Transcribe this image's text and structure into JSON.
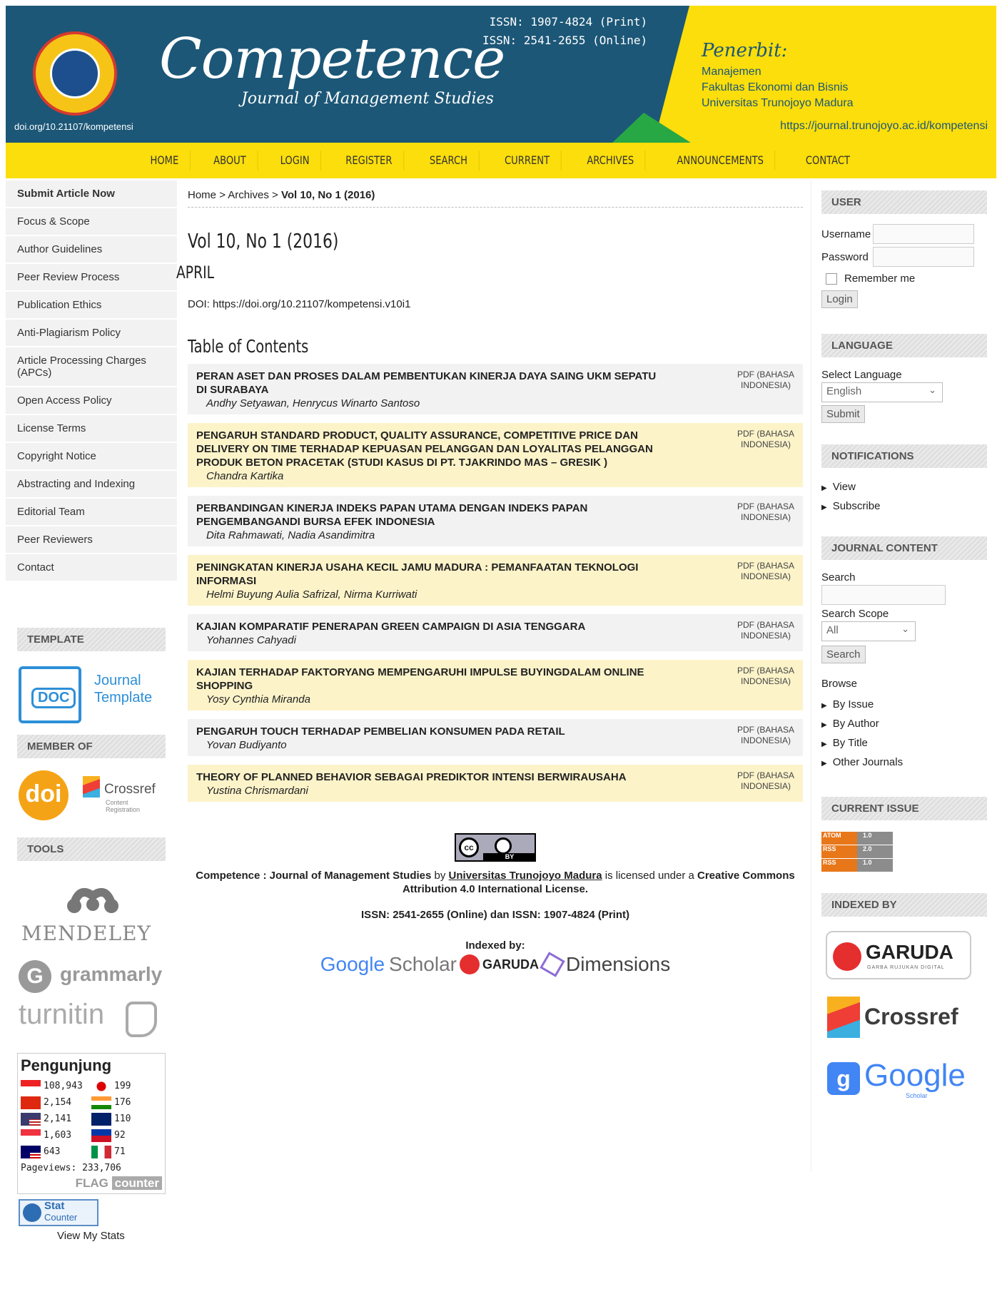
{
  "header": {
    "doi_link": "doi.org/10.21107/kompetensi",
    "brand": "Competence",
    "brand_sub": "Journal of Management Studies",
    "issn_print": "ISSN: 1907-4824 (Print)",
    "issn_online": "ISSN: 2541-2655 (Online)",
    "publisher_title": "Penerbit:",
    "publisher_lines": [
      "Manajemen",
      "Fakultas Ekonomi dan Bisnis",
      "Universitas Trunojoyo Madura"
    ],
    "journal_url": "https://journal.trunojoyo.ac.id/kompetensi"
  },
  "nav": [
    "HOME",
    "ABOUT",
    "LOGIN",
    "REGISTER",
    "SEARCH",
    "CURRENT",
    "ARCHIVES",
    "ANNOUNCEMENTS",
    "CONTACT"
  ],
  "left_menu": [
    "Submit Article Now",
    "Focus & Scope",
    "Author Guidelines",
    "Peer Review Process",
    "Publication Ethics",
    "Anti-Plagiarism Policy",
    "Article Processing Charges (APCs)",
    "Open Access Policy",
    "License Terms",
    "Copyright Notice",
    "Abstracting and Indexing",
    "Editorial Team",
    "Peer Reviewers",
    "Contact"
  ],
  "left_blocks": {
    "template_title": "TEMPLATE",
    "doc_label": "DOC",
    "template_text_1": "Journal",
    "template_text_2": "Template",
    "member_title": "MEMBER OF",
    "doi_logo": "doi",
    "crossref_logo": "Crossref",
    "crossref_sub_1": "Content",
    "crossref_sub_2": "Registration",
    "tools_title": "TOOLS",
    "mendeley": "MENDELEY",
    "grammarly": "grammarly",
    "turnitin": "turnitin"
  },
  "stats": {
    "title": "Pengunjung",
    "rows": [
      [
        "108,943",
        "199"
      ],
      [
        "2,154",
        "176"
      ],
      [
        "2,141",
        "110"
      ],
      [
        "1,603",
        "92"
      ],
      [
        "643",
        "71"
      ]
    ],
    "pageviews": "Pageviews: 233,706",
    "flag_label": "FLAG",
    "counter_label": "counter",
    "statcounter_1": "Stat",
    "statcounter_2": "Counter",
    "view_stats": "View My Stats"
  },
  "breadcrumb": {
    "home": "Home",
    "archives": "Archives",
    "sep": ">",
    "current": "Vol 10, No 1 (2016)"
  },
  "main": {
    "title": "Vol 10, No 1 (2016)",
    "subtitle": "APRIL",
    "doi": "DOI: https://doi.org/10.21107/kompetensi.v10i1",
    "toc_title": "Table of Contents",
    "pdf_label_1": "PDF (BAHASA",
    "pdf_label_2": "INDONESIA)"
  },
  "articles": [
    {
      "title": "PERAN ASET DAN PROSES DALAM PEMBENTUKAN KINERJA DAYA SAING UKM SEPATU DI SURABAYA",
      "authors": "Andhy Setyawan, Henrycus Winarto Santoso"
    },
    {
      "title": "PENGARUH STANDARD PRODUCT, QUALITY ASSURANCE, COMPETITIVE PRICE DAN DELIVERY ON TIME TERHADAP KEPUASAN PELANGGAN DAN LOYALITAS PELANGGAN PRODUK BETON PRACETAK (STUDI KASUS DI PT. TJAKRINDO MAS – GRESIK )",
      "authors": "Chandra Kartika"
    },
    {
      "title": "PERBANDINGAN KINERJA INDEKS PAPAN UTAMA DENGAN INDEKS PAPAN PENGEMBANGANDI BURSA EFEK INDONESIA",
      "authors": "Dita Rahmawati, Nadia Asandimitra"
    },
    {
      "title": "PENINGKATAN KINERJA USAHA KECIL JAMU MADURA : PEMANFAATAN TEKNOLOGI INFORMASI",
      "authors": "Helmi Buyung Aulia Safrizal, Nirma Kurriwati"
    },
    {
      "title": "KAJIAN KOMPARATIF PENERAPAN GREEN CAMPAIGN DI ASIA TENGGARA",
      "authors": "Yohannes Cahyadi"
    },
    {
      "title": "KAJIAN TERHADAP FAKTORYANG MEMPENGARUHI IMPULSE BUYINGDALAM ONLINE SHOPPING",
      "authors": "Yosy Cynthia Miranda"
    },
    {
      "title": "PENGARUH TOUCH TERHADAP PEMBELIAN KONSUMEN PADA RETAIL",
      "authors": "Yovan Budiyanto"
    },
    {
      "title": "THEORY OF PLANNED BEHAVIOR SEBAGAI PREDIKTOR INTENSI BERWIRAUSAHA",
      "authors": "Yustina Chrismardani"
    }
  ],
  "footer": {
    "cc_label": "cc",
    "by_label": "BY",
    "journal_name": "Competence : Journal of Management Studies",
    "by": "by",
    "university": "Universitas Trunojoyo Madura",
    "licensed": "is licensed under a",
    "license": "Creative Commons Attribution 4.0 International License.",
    "issn_line": "ISSN: 2541-2655 (Online) dan ISSN: 1907-4824 (Print)",
    "indexed_by": "Indexed by:",
    "google": "Google",
    "scholar": "Scholar",
    "garuda": "GARUDA",
    "dimensions": "Dimensions"
  },
  "right": {
    "user_title": "USER",
    "username_label": "Username",
    "password_label": "Password",
    "remember_label": "Remember me",
    "login_button": "Login",
    "language_title": "LANGUAGE",
    "select_language": "Select Language",
    "language_value": "English",
    "submit_button": "Submit",
    "notifications_title": "NOTIFICATIONS",
    "view": "View",
    "subscribe": "Subscribe",
    "journal_content_title": "JOURNAL CONTENT",
    "search_label": "Search",
    "search_scope_label": "Search Scope",
    "scope_value": "All",
    "search_button": "Search",
    "browse_label": "Browse",
    "browse_links": [
      "By Issue",
      "By Author",
      "By Title",
      "Other Journals"
    ],
    "current_issue_title": "CURRENT ISSUE",
    "feeds": [
      [
        "ATOM",
        "1.0"
      ],
      [
        "RSS",
        "2.0"
      ],
      [
        "RSS",
        "1.0"
      ]
    ],
    "indexed_title": "INDEXED BY",
    "idx_garuda": "GARUDA",
    "idx_garuda_sub": "GARBA RUJUKAN DIGITAL",
    "idx_crossref": "Crossref",
    "idx_google": "Google",
    "idx_scholar": "Scholar"
  },
  "colors": {
    "header_blue": "#1c5777",
    "header_yellow": "#fbde0b",
    "row_odd": "#f2f2f2",
    "row_even": "#fcf3c9"
  }
}
